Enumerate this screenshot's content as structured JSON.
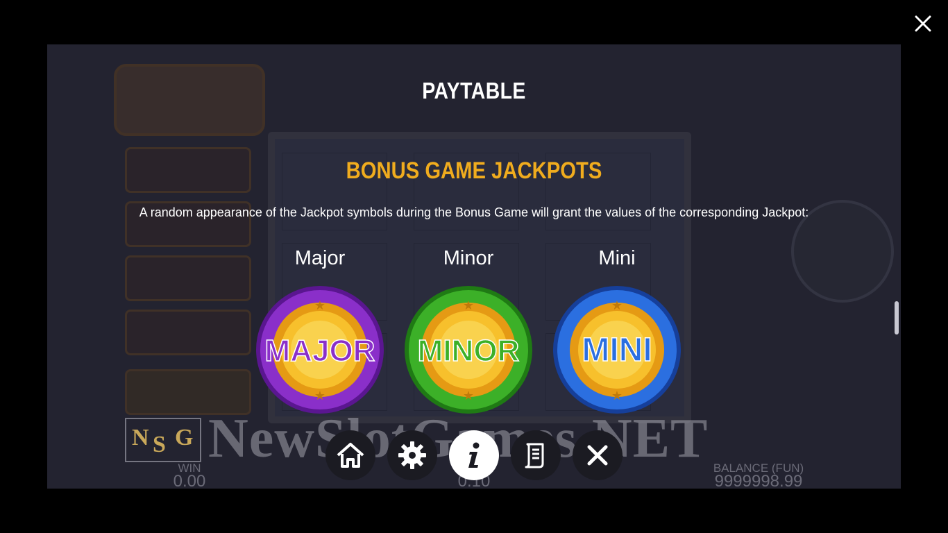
{
  "paytable": {
    "title": "PAYTABLE",
    "section_title": "BONUS GAME JACKPOTS",
    "description": "A random appearance of the Jackpot symbols during the Bonus Game will grant the values of the corresponding Jackpot:",
    "jackpots": [
      {
        "label": "Major",
        "coin_text": "MAJOR",
        "ring_color": "#8a2fc9",
        "ring_dark": "#5a1690"
      },
      {
        "label": "Minor",
        "coin_text": "MINOR",
        "ring_color": "#3cb028",
        "ring_dark": "#1f7a14"
      },
      {
        "label": "Mini",
        "coin_text": "MINI",
        "ring_color": "#2b6fe0",
        "ring_dark": "#163f9a"
      }
    ]
  },
  "background": {
    "win_label": "WIN",
    "win_value": "0.00",
    "bet_value": "0.10",
    "balance_label": "BALANCE (FUN)",
    "balance_value": "9999998.99"
  },
  "bottom_nav": [
    "home-icon",
    "gear-icon",
    "info-icon",
    "document-icon",
    "close-icon"
  ],
  "watermark": {
    "text": "NewSlotGames.NET",
    "logo_letters": [
      "N",
      "S",
      "G"
    ]
  },
  "colors": {
    "accent_gold": "#f0ac1e",
    "overlay_bg": "#2a2a38"
  }
}
